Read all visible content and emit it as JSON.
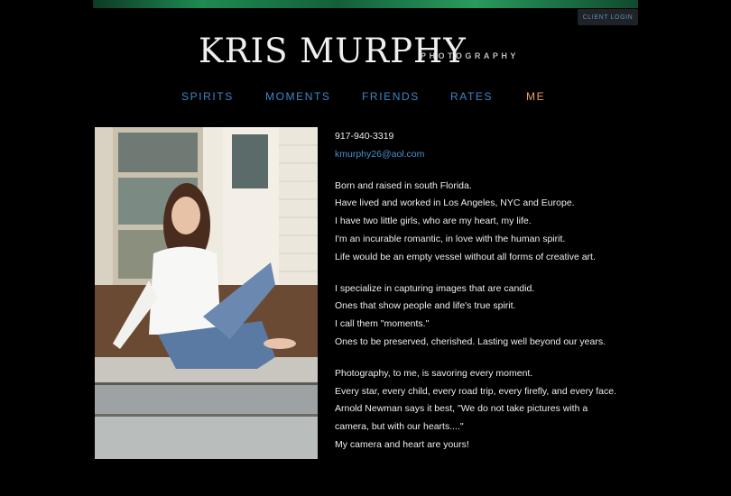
{
  "header": {
    "client_login": "CLIENT LOGIN",
    "logo_title": "KRIS MURPHY",
    "logo_subtitle": "PHOTOGRAPHY"
  },
  "nav": {
    "items": [
      {
        "label": "SPIRITS",
        "active": false
      },
      {
        "label": "MOMENTS",
        "active": false
      },
      {
        "label": "FRIENDS",
        "active": false
      },
      {
        "label": "RATES",
        "active": false
      },
      {
        "label": "ME",
        "active": true
      }
    ]
  },
  "colors": {
    "nav_link": "#3d87c9",
    "nav_active": "#f2a15a",
    "email_link": "#4a8fd0",
    "background": "#000000"
  },
  "portrait": {
    "icon": "portrait-photo"
  },
  "contact": {
    "phone": "917-940-3319",
    "email": "kmurphy26@aol.com"
  },
  "bio": {
    "paragraph1": [
      "Born and raised in south Florida.",
      "Have lived and worked in Los Angeles, NYC and Europe.",
      "I have two little girls, who are my heart, my life.",
      "I'm an incurable romantic, in love with the human spirit.",
      "Life would be an empty vessel without all forms of creative art."
    ],
    "paragraph2": [
      "I specialize in capturing images that are candid.",
      "Ones that show people and life's true spirit.",
      "I call them \"moments.\"",
      "Ones to be preserved, cherished. Lasting well beyond our years."
    ],
    "paragraph3": [
      "Photography, to me, is savoring every moment.",
      "Every star, every child, every road trip, every firefly, and every face.",
      "Arnold Newman says it best, \"We do not take pictures with a",
      "camera, but with our hearts....\"",
      "My camera and heart are yours!"
    ]
  }
}
